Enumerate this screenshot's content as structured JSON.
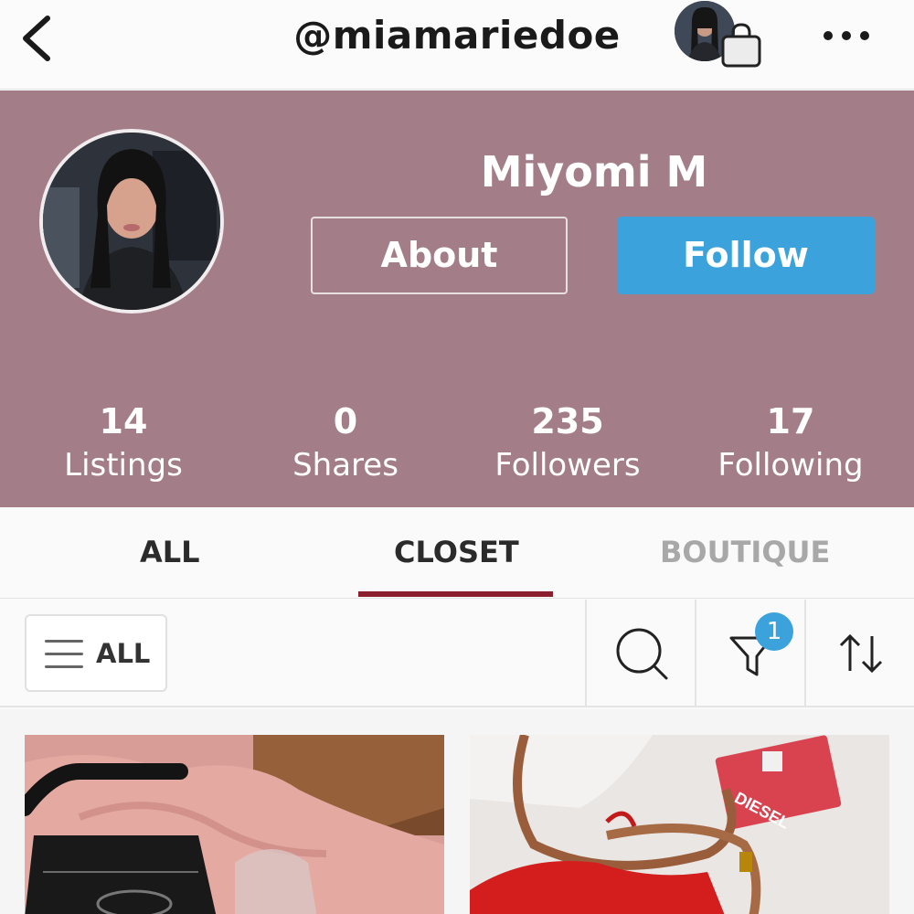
{
  "topbar": {
    "handle": "@miamariedoe",
    "icons": {
      "back": "chevron-left-icon",
      "bag": "shopping-bag-icon",
      "more": "more-dots-icon"
    }
  },
  "profile": {
    "name": "Miyomi M",
    "about_label": "About",
    "follow_label": "Follow",
    "header_color": "#a37d88",
    "follow_color": "#3ba2dc",
    "stats": [
      {
        "value": "14",
        "label": "Listings"
      },
      {
        "value": "0",
        "label": "Shares"
      },
      {
        "value": "235",
        "label": "Followers"
      },
      {
        "value": "17",
        "label": "Following"
      }
    ]
  },
  "tabs": [
    {
      "label": "ALL",
      "active": false
    },
    {
      "label": "CLOSET",
      "active": true
    },
    {
      "label": "BOUTIQUE",
      "active": false
    }
  ],
  "accent_color": "#8b1f2d",
  "toolbar": {
    "filter_label": "ALL",
    "filter_badge": "1",
    "icons": [
      "menu-icon",
      "search-icon",
      "filter-funnel-icon",
      "sort-icon"
    ]
  },
  "listings": [
    {
      "image": "black-handbag-on-pink-velvet-photo"
    },
    {
      "image": "red-knit-with-leather-belt-and-diesel-tags-photo"
    }
  ]
}
